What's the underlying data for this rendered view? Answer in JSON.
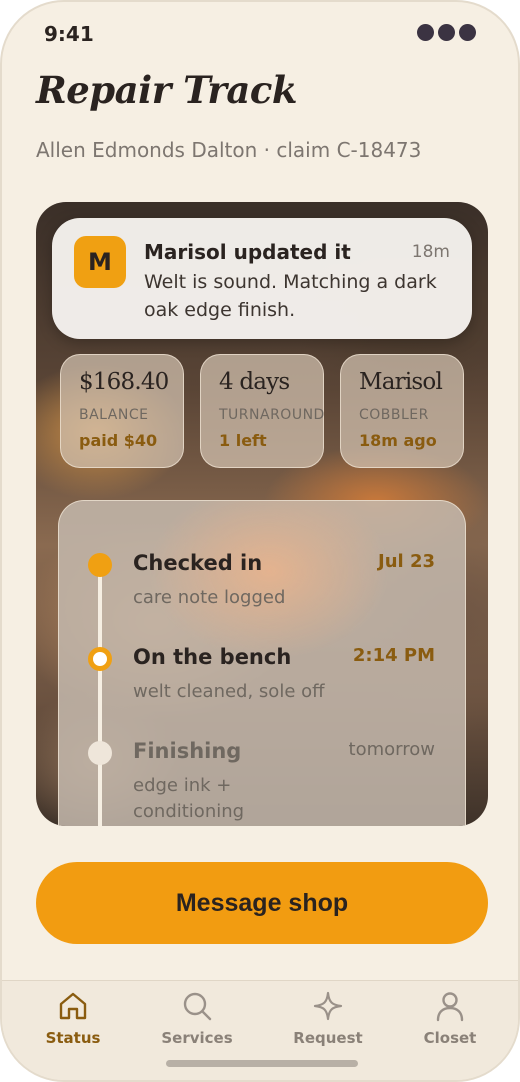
{
  "status_bar": {
    "time": "9:41"
  },
  "header": {
    "title": "Repair Track",
    "subtitle": "Allen Edmonds Dalton · claim C-18473"
  },
  "notification": {
    "avatar_letter": "M",
    "title": "Marisol updated it",
    "time": "18m",
    "body": "Welt is sound. Matching a dark oak edge finish."
  },
  "stats": [
    {
      "value": "$168.40",
      "label": "BALANCE",
      "sub": "paid $40"
    },
    {
      "value": "4 days",
      "label": "TURNAROUND",
      "sub": "1 left"
    },
    {
      "value": "Marisol",
      "label": "COBBLER",
      "sub": "18m ago"
    }
  ],
  "timeline": [
    {
      "title": "Checked in",
      "note": "care note logged",
      "when": "Jul 23",
      "state": "done"
    },
    {
      "title": "On the bench",
      "note": "welt cleaned, sole off",
      "when": "2:14 PM",
      "state": "current"
    },
    {
      "title": "Finishing",
      "note": "edge ink + conditioning",
      "when": "tomorrow",
      "state": "pending"
    }
  ],
  "cta": {
    "label": "Message shop"
  },
  "tabbar": {
    "items": [
      {
        "label": "Status",
        "icon": "home-icon",
        "active": true
      },
      {
        "label": "Services",
        "icon": "search-icon",
        "active": false
      },
      {
        "label": "Request",
        "icon": "sparkle-icon",
        "active": false
      },
      {
        "label": "Closet",
        "icon": "person-icon",
        "active": false
      }
    ]
  },
  "colors": {
    "accent": "#f29c11",
    "accent_text": "#8a5c10",
    "background": "#f6efe3",
    "ink": "#2a2320"
  }
}
